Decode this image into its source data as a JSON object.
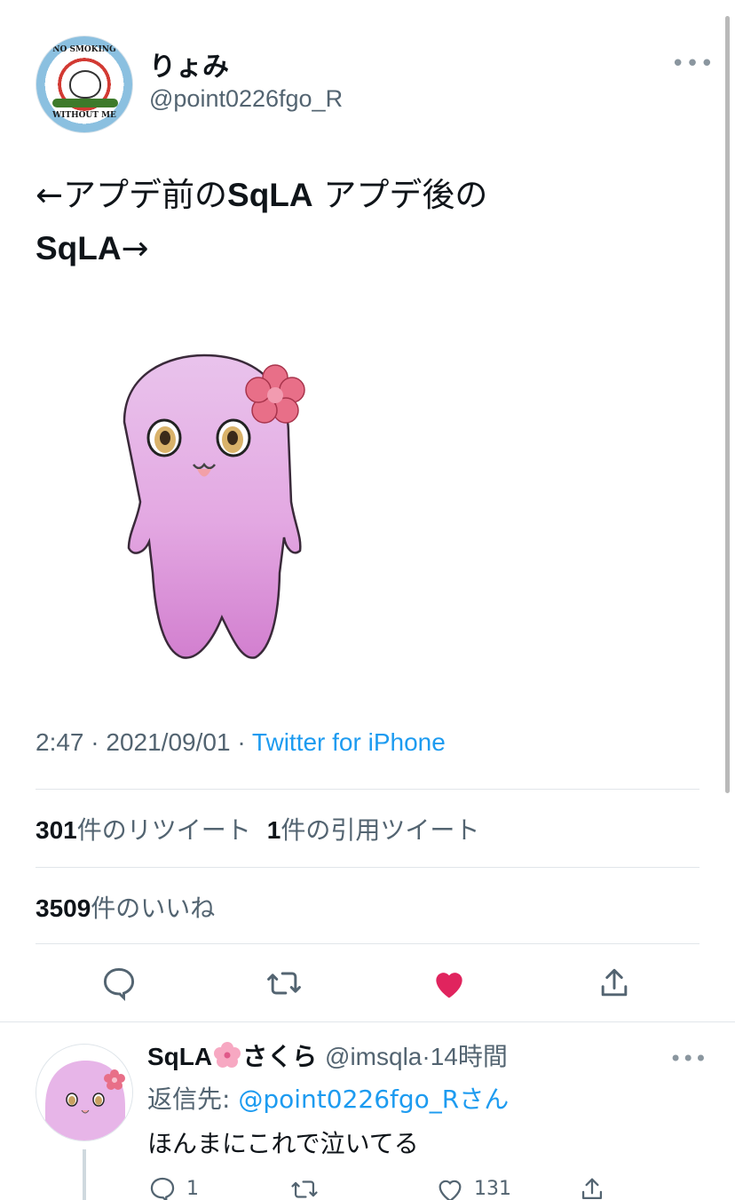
{
  "tweet": {
    "author": {
      "display_name": "りょみ",
      "handle": "@point0226fgo_R"
    },
    "text": {
      "part1": "←アプデ前の",
      "bold1": "SqLA",
      "part2": " アプデ後の",
      "bold2": "SqLA",
      "part3": "→"
    },
    "time": "2:47",
    "separator": "·",
    "date": "2021/09/01",
    "source": "Twitter for iPhone",
    "stats": {
      "retweet_count": "301",
      "retweet_label": "件のリツイート",
      "quote_count": "1",
      "quote_label": "件の引用ツイート",
      "like_count": "3509",
      "like_label": "件のいいね"
    },
    "actions": {
      "reply_icon": "reply-icon",
      "retweet_icon": "retweet-icon",
      "like_icon": "heart-filled-icon",
      "share_icon": "share-icon"
    }
  },
  "reply": {
    "name_prefix": "SqLA",
    "name_suffix": "さくら",
    "handle": "@imsqla",
    "separator": "·",
    "time_ago": "14時間",
    "reply_to_label": "返信先: ",
    "reply_to_mention": "@point0226fgo_Rさん",
    "text": "ほんまにこれで泣いてる",
    "reply_count": "1",
    "like_count": "131"
  },
  "colors": {
    "link": "#1d9bf0",
    "like": "#f91880",
    "muted": "#536471",
    "character_pink": "#e7b5e8"
  }
}
